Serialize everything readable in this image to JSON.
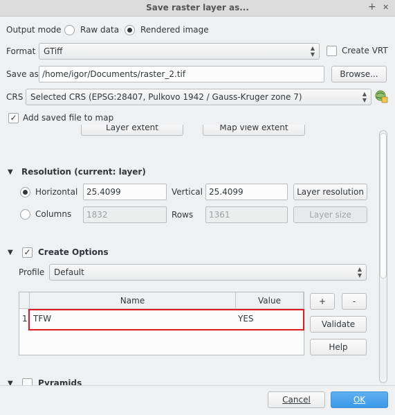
{
  "window": {
    "title": "Save raster layer as...",
    "pin_icon": "+",
    "close_icon": "✕"
  },
  "output_mode": {
    "label": "Output mode",
    "raw_data": "Raw data",
    "rendered_image": "Rendered image",
    "selected": "rendered_image"
  },
  "format": {
    "label": "Format",
    "value": "GTiff",
    "create_vrt": "Create VRT"
  },
  "save_as": {
    "label": "Save as",
    "value": "/home/igor/Documents/raster_2.tif",
    "browse": "Browse..."
  },
  "crs": {
    "label": "CRS",
    "value": "Selected CRS (EPSG:28407, Pulkovo 1942 / Gauss-Kruger zone 7)"
  },
  "add_to_map": {
    "label": "Add saved file to map",
    "checked": true
  },
  "extent_buttons": {
    "layer_extent": "Layer extent",
    "map_view_extent": "Map view extent"
  },
  "resolution": {
    "title": "Resolution (current: layer)",
    "horizontal_label": "Horizontal",
    "horizontal_value": "25.4099",
    "vertical_label": "Vertical",
    "vertical_value": "25.4099",
    "layer_resolution": "Layer resolution",
    "columns_label": "Columns",
    "columns_value": "1832",
    "rows_label": "Rows",
    "rows_value": "1361",
    "layer_size": "Layer size"
  },
  "create_options": {
    "title": "Create Options",
    "checked": true,
    "profile_label": "Profile",
    "profile_value": "Default",
    "columns": [
      "Name",
      "Value"
    ],
    "rows": [
      {
        "index": "1",
        "name": "TFW",
        "value": "YES"
      }
    ],
    "add": "+",
    "remove": "-",
    "validate": "Validate",
    "help": "Help"
  },
  "pyramids": {
    "title": "Pyramids"
  },
  "footer": {
    "cancel": "Cancel",
    "ok": "OK"
  },
  "colors": {
    "accent": "#3d9ae8",
    "highlight_border": "#e0191f"
  }
}
